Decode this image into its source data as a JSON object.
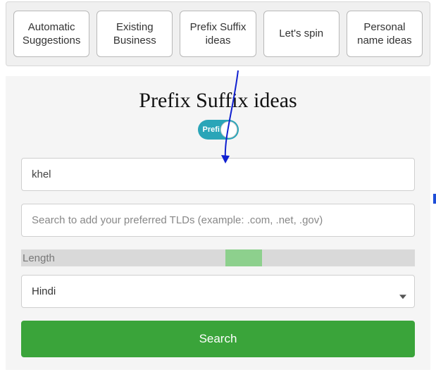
{
  "tabs": {
    "0": "Automatic Suggestions",
    "1": "Existing Business",
    "2": "Prefix Suffix ideas",
    "3": "Let's spin",
    "4": "Personal name ideas"
  },
  "panel": {
    "heading": "Prefix Suffix ideas",
    "toggle_label": "Prefi",
    "keyword_value": "khel",
    "tld_placeholder": "Search to add your preferred TLDs (example: .com, .net, .gov)",
    "length_label": "Length",
    "language_value": "Hindi",
    "search_label": "Search"
  }
}
